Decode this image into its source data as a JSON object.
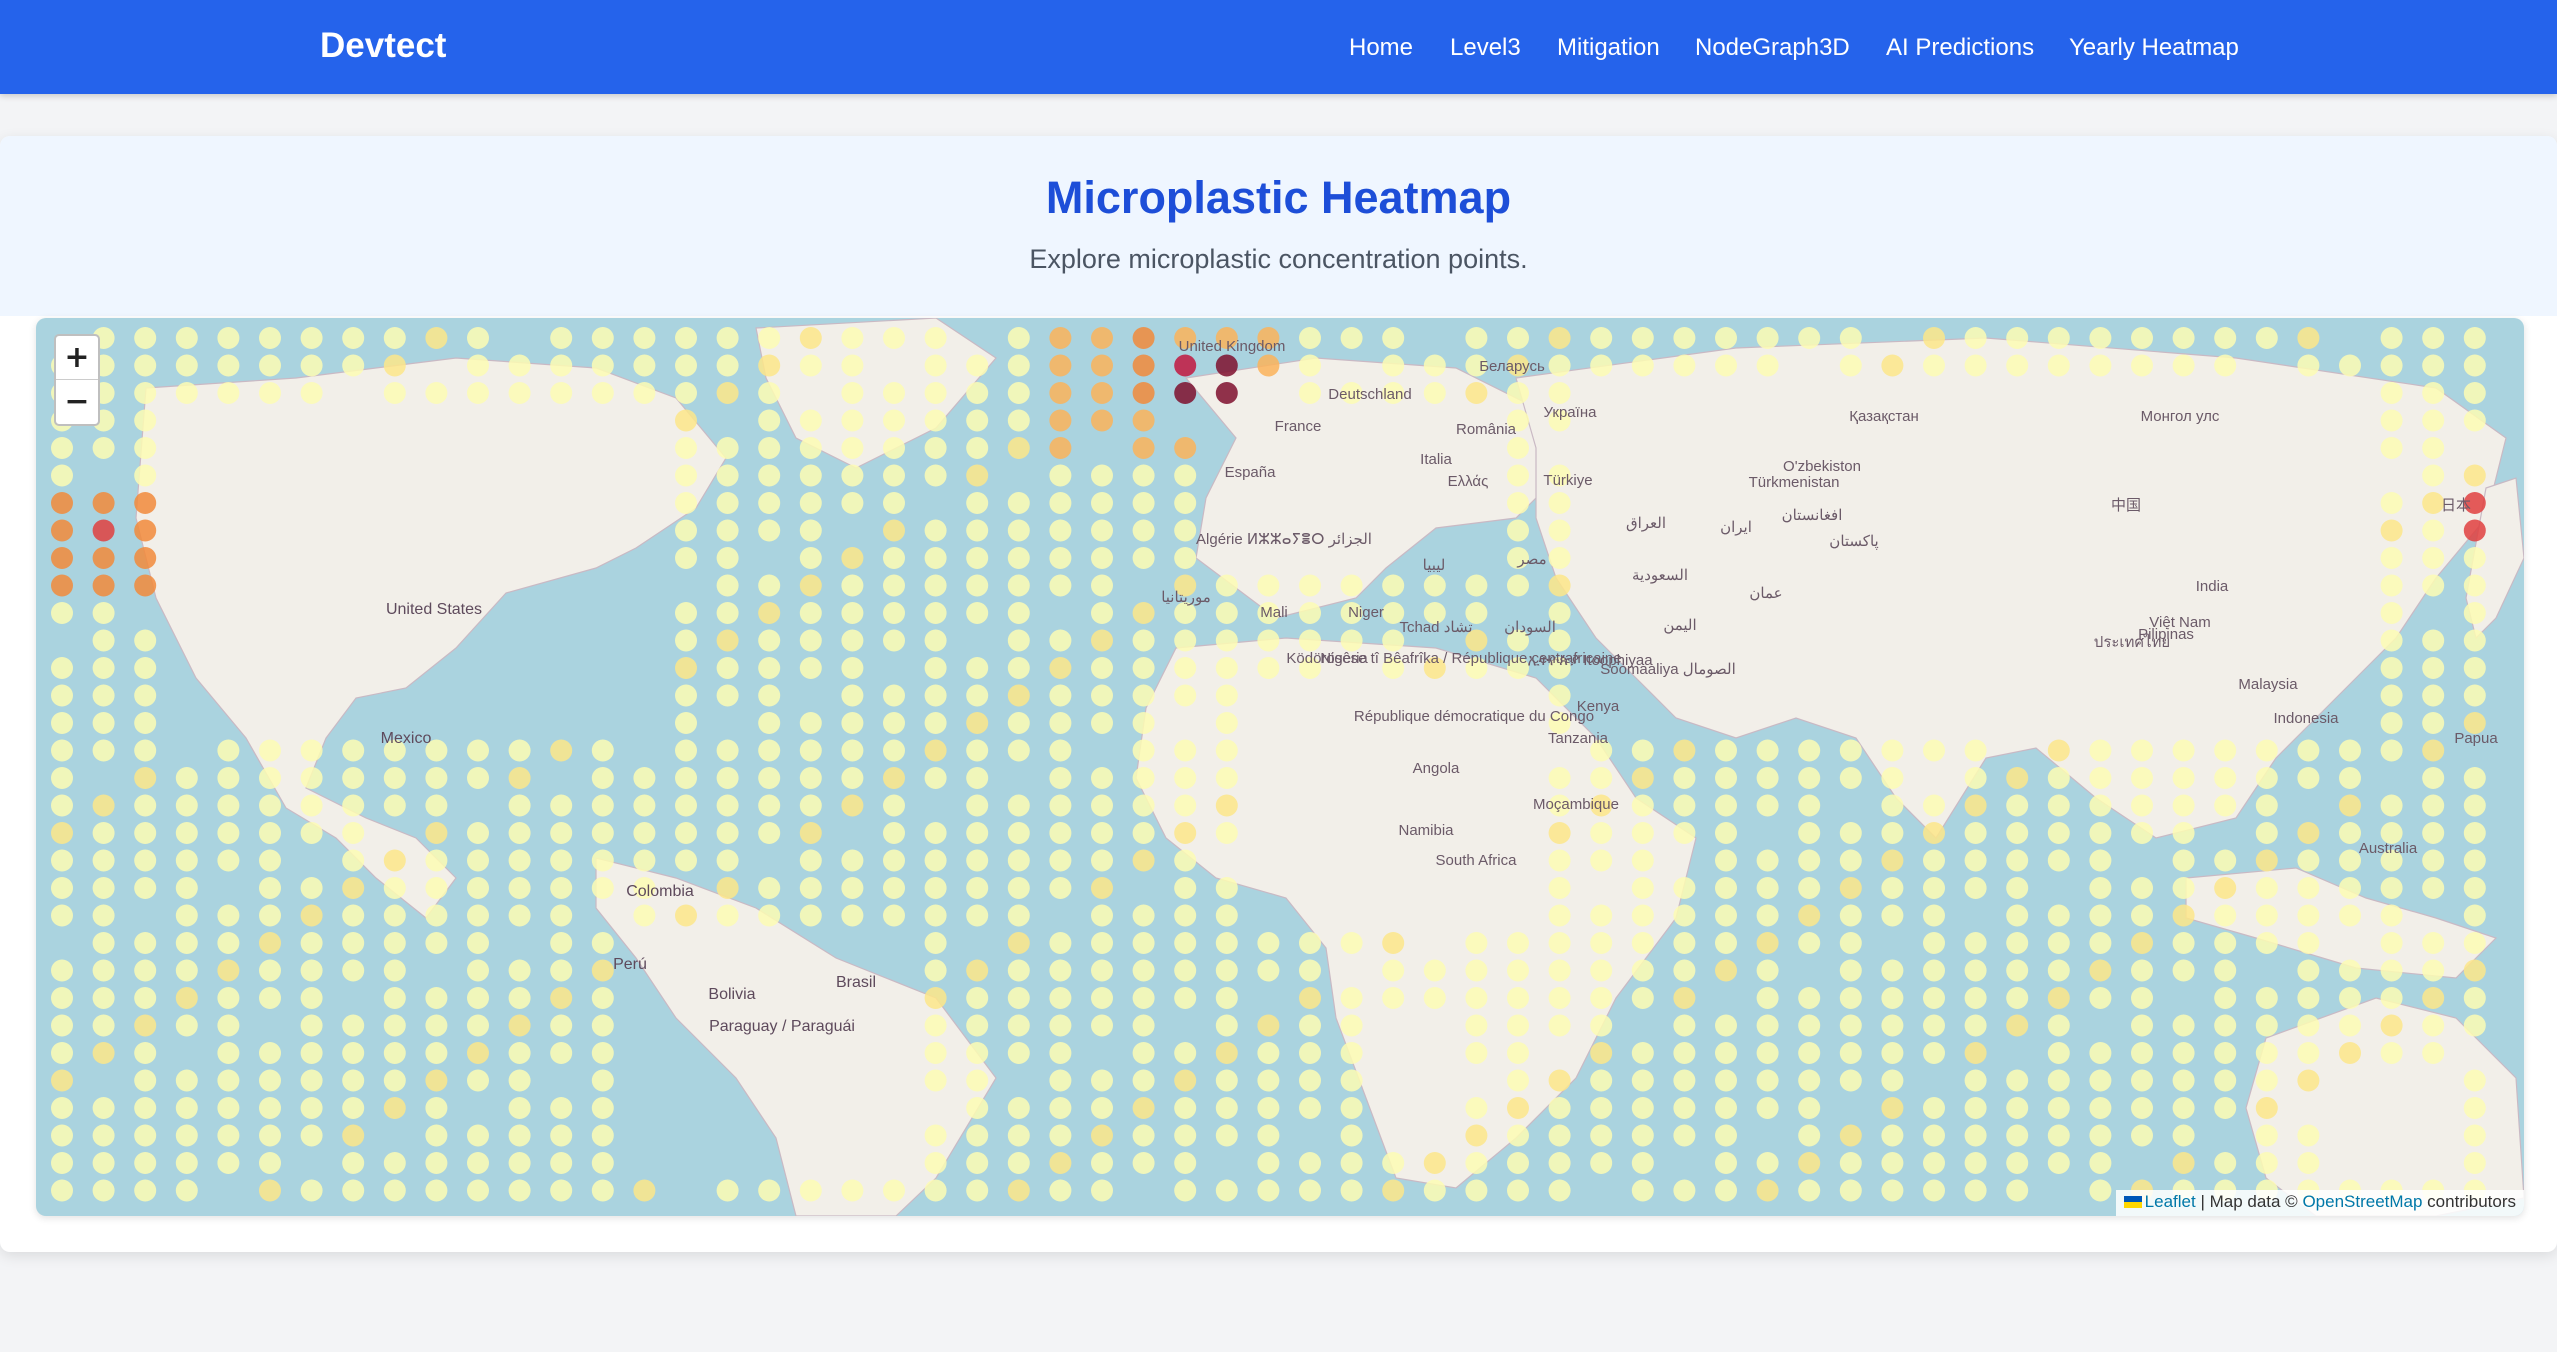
{
  "navbar": {
    "brand": "Devtect",
    "links": [
      "Home",
      "Level3",
      "Mitigation",
      "NodeGraph3D",
      "AI Predictions",
      "Yearly Heatmap"
    ]
  },
  "page": {
    "title": "Microplastic Heatmap",
    "subtitle": "Explore microplastic concentration points."
  },
  "map": {
    "zoom_in": "+",
    "zoom_out": "−",
    "attribution": {
      "leaflet": "Leaflet",
      "middle": " | Map data © ",
      "osm": "OpenStreetMap",
      "suffix": " contributors"
    },
    "labels": [
      "United States",
      "Mexico",
      "Colombia",
      "Perú",
      "Bolivia",
      "Brasil",
      "Paraguay / Paraguái",
      "United Kingdom",
      "Deutschland",
      "France",
      "España",
      "Italia",
      "Ελλάς",
      "România",
      "Україна",
      "Беларусь",
      "Algérie ⵍⵣⵣⴰⵢⴻⵔ الجزائر",
      "ليبيا",
      "مصر",
      "موريتانيا",
      "Mali",
      "Niger",
      "Tchad تشاد",
      "السودان",
      "Nigeria",
      "Ködörösêse tî Bêafrîka / République centrafricaine",
      "République démocratique du Congo",
      "Kenya",
      "Tanzania",
      "Soomaaliya الصومال",
      "Angola",
      "Namibia",
      "Moçambique",
      "South Africa",
      "Türkiye",
      "Türkmenistan",
      "O'zbekiston",
      "Қазақстан",
      "Монгол улс",
      "中国",
      "日本",
      "India",
      "ایران",
      "افغانستان",
      "پاکستان",
      "السعودية",
      "عمان",
      "اليمن",
      "العراق",
      "Việt Nam",
      "ประเทศไทย",
      "Pilipinas",
      "Malaysia",
      "Indonesia",
      "Papua",
      "Australia",
      "ኢትዮጵያ Itoophiyaa"
    ],
    "legend_colors": {
      "low": "#fdfcb4",
      "low_mid": "#fde68a",
      "mid": "#fbb35a",
      "mid_high": "#f28a3b",
      "high": "#e03f3f",
      "very_high": "#c2163f",
      "extreme": "#7f0f2e",
      "ocean": "#aad3df",
      "land": "#f2efe9"
    }
  }
}
